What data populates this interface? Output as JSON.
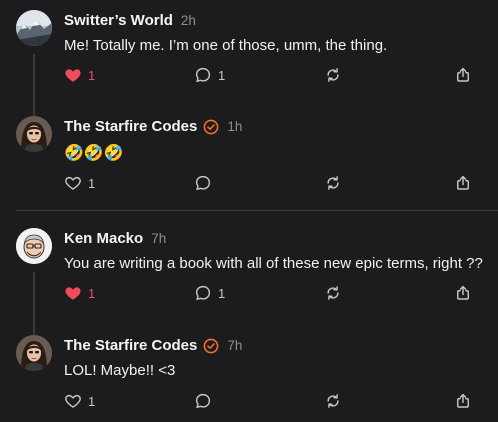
{
  "posts": [
    {
      "author": "Switter’s World",
      "time": "2h",
      "verified": false,
      "text": "Me! Totally me. I’m one of those, umm, the thing.",
      "likes": "1",
      "liked": true,
      "replies": "1",
      "avatar_icon": "mountain-avatar-icon"
    },
    {
      "author": "The Starfire Codes",
      "time": "1h",
      "verified": true,
      "text": "🤣🤣🤣",
      "likes": "1",
      "liked": false,
      "replies": "",
      "avatar_icon": "woman-avatar-icon"
    },
    {
      "author": "Ken Macko",
      "time": "7h",
      "verified": false,
      "text": "You are writing a book with all of these new epic terms, right ??",
      "likes": "1",
      "liked": true,
      "replies": "1",
      "avatar_icon": "cartoon-man-avatar-icon"
    },
    {
      "author": "The Starfire Codes",
      "time": "7h",
      "verified": true,
      "text": "LOL! Maybe!! <3",
      "likes": "1",
      "liked": false,
      "replies": "",
      "avatar_icon": "woman-avatar-icon"
    }
  ],
  "colors": {
    "background": "#1c1c1e",
    "like_red": "#ef4c5c",
    "verified_orange": "#f36b2b",
    "muted": "#8e8e93"
  }
}
